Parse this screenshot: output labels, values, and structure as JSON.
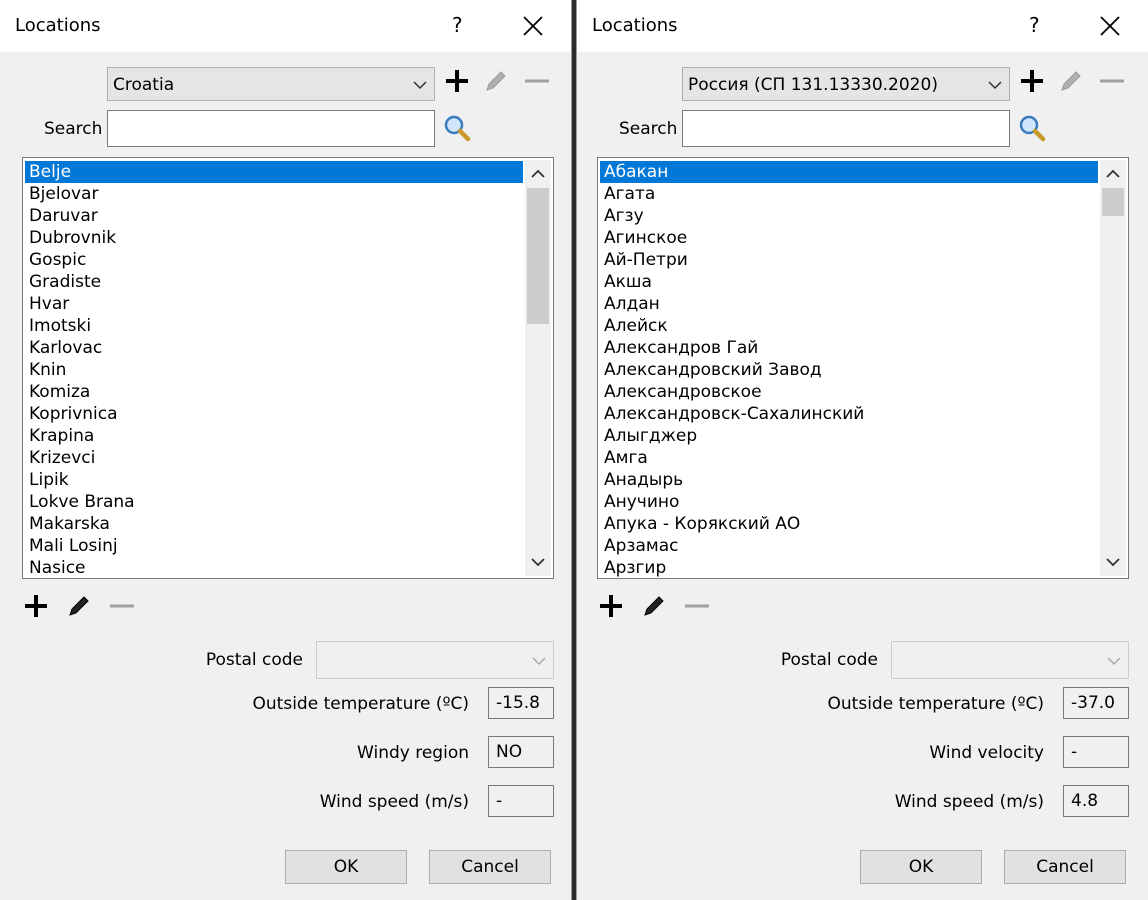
{
  "left": {
    "title": "Locations",
    "help": "?",
    "country": "Croatia",
    "search_label": "Search",
    "search_value": "",
    "locations": [
      "Belje",
      "Bjelovar",
      "Daruvar",
      "Dubrovnik",
      "Gospic",
      "Gradiste",
      "Hvar",
      "Imotski",
      "Karlovac",
      "Knin",
      "Komiza",
      "Koprivnica",
      "Krapina",
      "Krizevci",
      "Lipik",
      "Lokve Brana",
      "Makarska",
      "Mali Losinj",
      "Nasice"
    ],
    "selected": "Belje",
    "postal_code_label": "Postal code",
    "postal_code_value": "",
    "fields": [
      {
        "label": "Outside temperature (ºC)",
        "value": "-15.8"
      },
      {
        "label": "Windy region",
        "value": "NO"
      },
      {
        "label": "Wind speed (m/s)",
        "value": "-"
      }
    ],
    "ok": "OK",
    "cancel": "Cancel"
  },
  "right": {
    "title": "Locations",
    "help": "?",
    "country": "Россия (СП 131.13330.2020)",
    "search_label": "Search",
    "search_value": "",
    "locations": [
      "Абакан",
      "Агата",
      "Агзу",
      "Агинское",
      "Ай-Петри",
      "Акша",
      "Алдан",
      "Алейск",
      "Александров Гай",
      "Александровский Завод",
      "Александровское",
      "Александровск-Сахалинский",
      "Алыгджер",
      "Амга",
      "Анадырь",
      "Анучино",
      "Апука - Корякский АО",
      "Арзамас",
      "Арзгир"
    ],
    "selected": "Абакан",
    "postal_code_label": "Postal code",
    "postal_code_value": "",
    "fields": [
      {
        "label": "Outside temperature (ºC)",
        "value": "-37.0"
      },
      {
        "label": "Wind velocity",
        "value": "-"
      },
      {
        "label": "Wind speed (m/s)",
        "value": "4.8"
      }
    ],
    "ok": "OK",
    "cancel": "Cancel"
  },
  "colors": {
    "selection": "#0078d7",
    "dialog_bg": "#f0f0f0",
    "titlebar_bg": "#ffffff"
  },
  "icons": [
    "close-icon",
    "plus-icon",
    "pencil-icon",
    "minus-icon",
    "search-icon",
    "chevron-down-icon",
    "chevron-up-icon"
  ]
}
